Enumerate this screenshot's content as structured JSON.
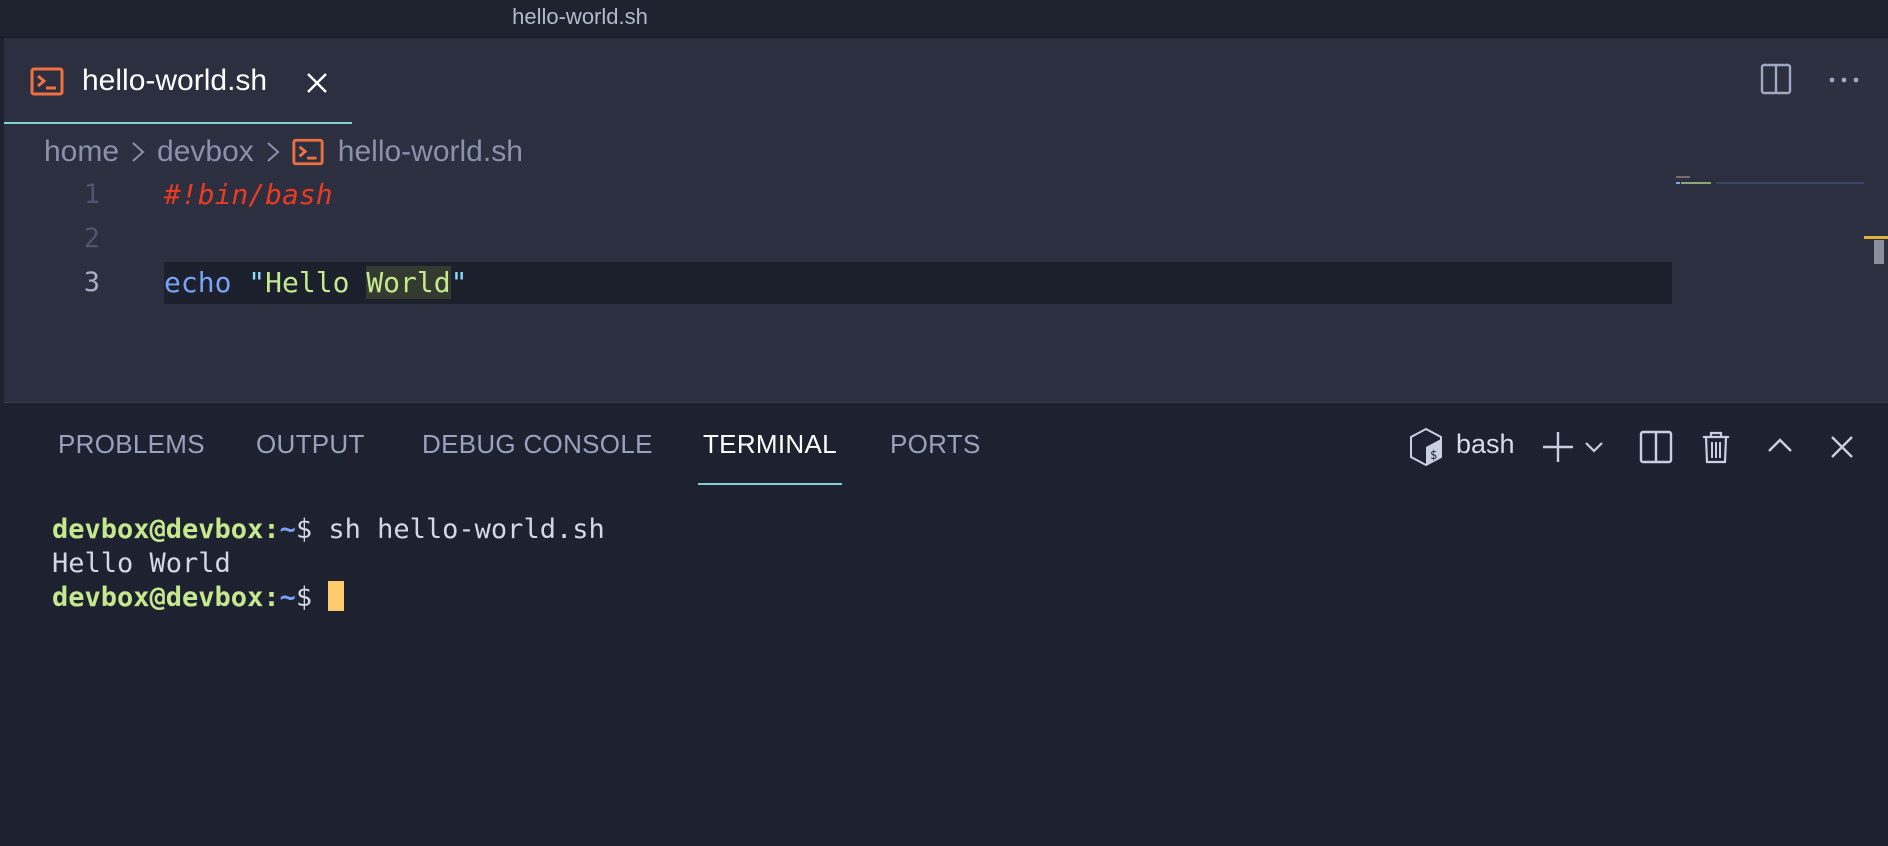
{
  "window": {
    "title": "hello-world.sh"
  },
  "editor": {
    "tab": {
      "label": "hello-world.sh",
      "icon": "terminal-file-icon",
      "icon_color": "#f07040"
    },
    "breadcrumb": [
      "home",
      "devbox",
      "hello-world.sh"
    ],
    "lines": [
      {
        "number": "1",
        "comment": "#!bin/bash"
      },
      {
        "number": "2"
      },
      {
        "number": "3",
        "cmd": "echo",
        "quote_open": "\"",
        "str1": "Hello ",
        "str2": "World",
        "quote_close": "\""
      }
    ]
  },
  "panel": {
    "tabs": [
      "PROBLEMS",
      "OUTPUT",
      "DEBUG CONSOLE",
      "TERMINAL",
      "PORTS"
    ],
    "active_tab": "TERMINAL",
    "shell_name": "bash",
    "accent": "#7fd1d5"
  },
  "terminal": {
    "prompt_user": "devbox@devbox",
    "prompt_sep": ":",
    "prompt_path": "~",
    "prompt_end": "$ ",
    "command": "sh hello-world.sh",
    "output": "Hello World"
  }
}
